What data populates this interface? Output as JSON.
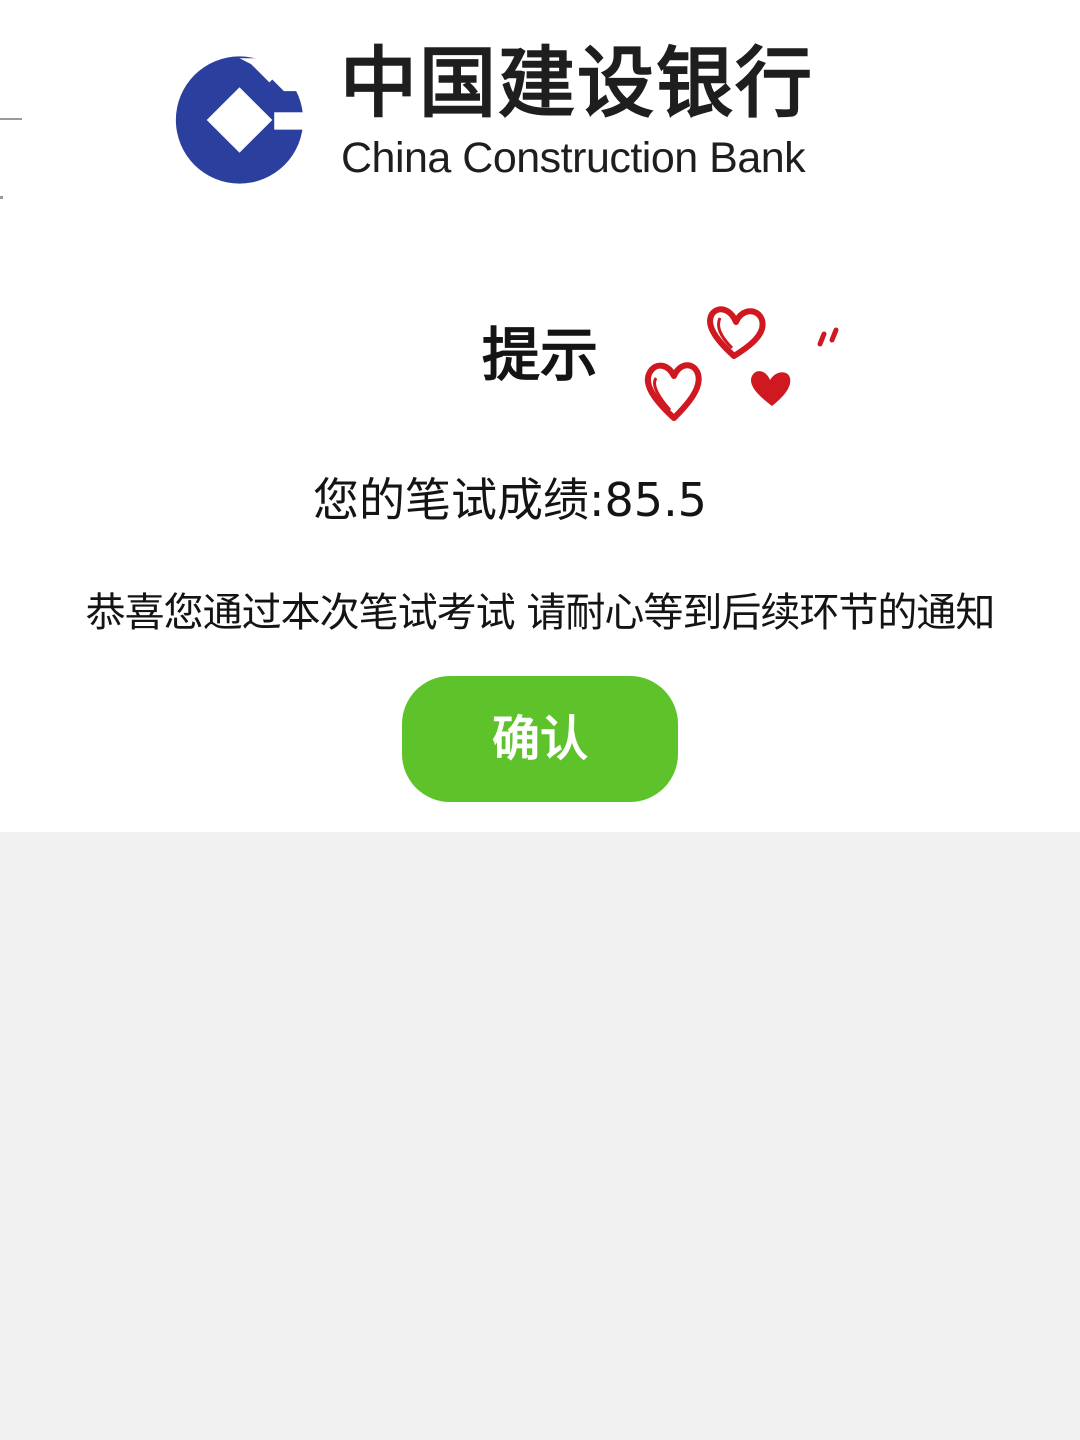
{
  "logo": {
    "name_cn": "中国建设银行",
    "name_en": "China Construction Bank",
    "brand_color": "#2b3f9e"
  },
  "dialog": {
    "title": "提示",
    "score_label": "您的笔试成绩:",
    "score_value": "85.5",
    "message": "恭喜您通过本次笔试考试 请耐心等到后续环节的通知",
    "confirm_label": "确认",
    "confirm_color": "#5ec22b"
  },
  "decoration": {
    "icon": "hand-drawn-hearts",
    "color": "#d01820"
  },
  "colors": {
    "panel": "#ffffff",
    "backdrop": "#f1f1f1",
    "text": "#141414"
  }
}
